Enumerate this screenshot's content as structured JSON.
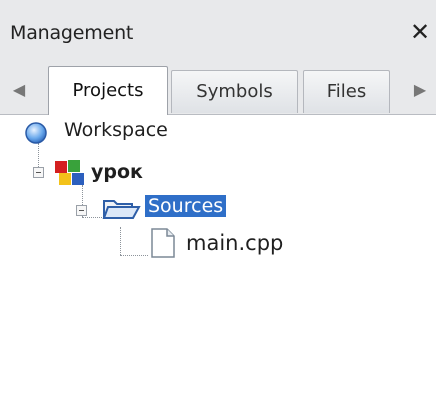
{
  "panel": {
    "title": "Management",
    "close_glyph": "✕"
  },
  "tabs": {
    "scroll_left_glyph": "◀",
    "scroll_right_glyph": "▶",
    "items": [
      {
        "label": "Projects",
        "active": true
      },
      {
        "label": "Symbols",
        "active": false
      },
      {
        "label": "Files",
        "active": false
      }
    ]
  },
  "tree": {
    "workspace": {
      "label": "Workspace",
      "icon": "workspace-globe-icon"
    },
    "project": {
      "label": "урок",
      "icon": "project-cubes-icon"
    },
    "folder": {
      "label": "Sources",
      "icon": "folder-open-icon",
      "selected": true
    },
    "file": {
      "label": "main.cpp",
      "icon": "document-icon"
    }
  },
  "colors": {
    "selection": "#2f6fc8",
    "panel_bg": "#e8e9eb"
  }
}
